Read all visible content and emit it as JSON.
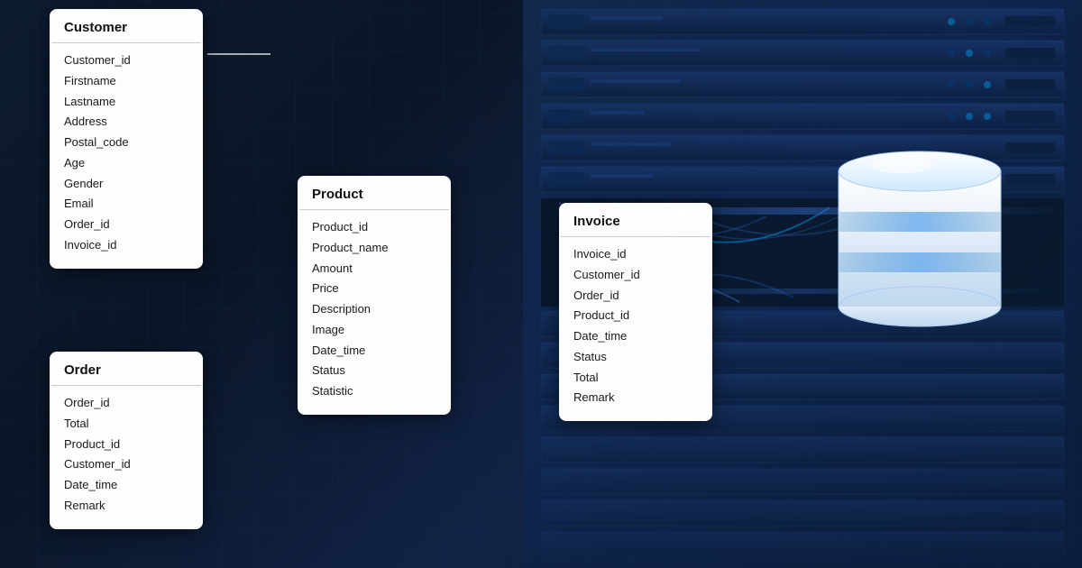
{
  "background": {
    "color": "#0a1628"
  },
  "tables": {
    "customer": {
      "title": "Customer",
      "fields": [
        "Customer_id",
        "Firstname",
        "Lastname",
        "Address",
        "Postal_code",
        "Age",
        "Gender",
        "Email",
        "Order_id",
        "Invoice_id"
      ]
    },
    "order": {
      "title": "Order",
      "fields": [
        "Order_id",
        "Total",
        "Product_id",
        "Customer_id",
        "Date_time",
        "Remark"
      ]
    },
    "product": {
      "title": "Product",
      "fields": [
        "Product_id",
        "Product_name",
        "Amount",
        "Price",
        "Description",
        "Image",
        "Date_time",
        "Status",
        "Statistic"
      ]
    },
    "invoice": {
      "title": "Invoice",
      "fields": [
        "Invoice_id",
        "Customer_id",
        "Order_id",
        "Product_id",
        "Date_time",
        "Status",
        "Total",
        "Remark"
      ]
    }
  }
}
